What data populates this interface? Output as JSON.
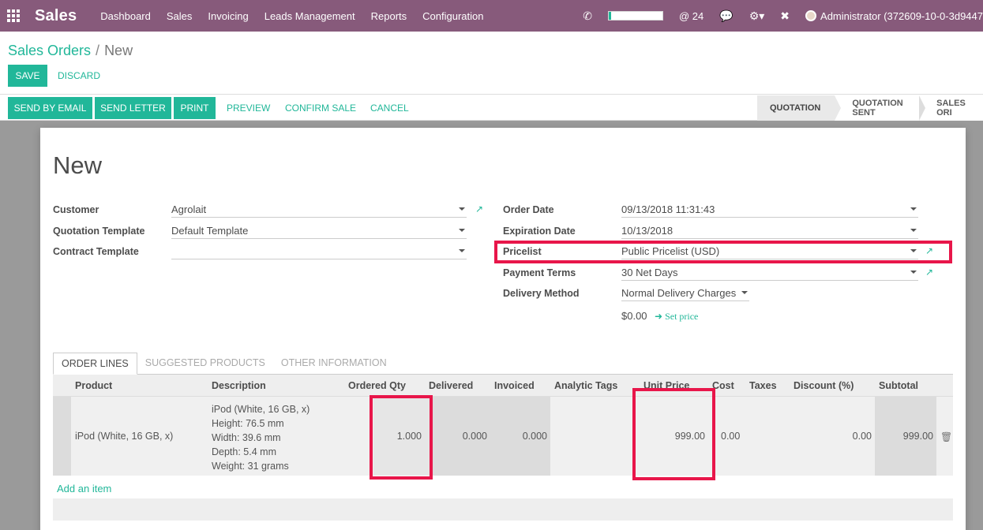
{
  "navbar": {
    "brand": "Sales",
    "menu": [
      "Dashboard",
      "Sales",
      "Invoicing",
      "Leads Management",
      "Reports",
      "Configuration"
    ],
    "progress_fraction": 0.05,
    "mentions": "@ 24",
    "user": "Administrator (372609-10-0-3d9447"
  },
  "breadcrumb": {
    "parent": "Sales Orders",
    "separator": "/",
    "current": "New"
  },
  "buttons": {
    "save": "SAVE",
    "discard": "DISCARD",
    "send_by_email": "SEND BY EMAIL",
    "send_letter": "SEND LETTER",
    "print": "PRINT",
    "preview": "PREVIEW",
    "confirm_sale": "CONFIRM SALE",
    "cancel": "CANCEL"
  },
  "status_bar": [
    "QUOTATION",
    "QUOTATION SENT",
    "SALES ORI"
  ],
  "form": {
    "title": "New",
    "customer": {
      "label": "Customer",
      "value": "Agrolait"
    },
    "quotation_template": {
      "label": "Quotation Template",
      "value": "Default Template"
    },
    "contract_template": {
      "label": "Contract Template",
      "value": ""
    },
    "order_date": {
      "label": "Order Date",
      "value": "09/13/2018 11:31:43"
    },
    "expiration_date": {
      "label": "Expiration Date",
      "value": "10/13/2018"
    },
    "pricelist": {
      "label": "Pricelist",
      "value": "Public Pricelist (USD)"
    },
    "payment_terms": {
      "label": "Payment Terms",
      "value": "30 Net Days"
    },
    "delivery_method": {
      "label": "Delivery Method",
      "value": "Normal Delivery Charges"
    },
    "delivery_amount": "$0.00",
    "set_price": "Set price"
  },
  "tabs": [
    "ORDER LINES",
    "SUGGESTED PRODUCTS",
    "OTHER INFORMATION"
  ],
  "table": {
    "headers": [
      "Product",
      "Description",
      "Ordered Qty",
      "Delivered",
      "Invoiced",
      "Analytic Tags",
      "Unit Price",
      "Cost",
      "Taxes",
      "Discount (%)",
      "Subtotal"
    ],
    "rows": [
      {
        "product": "iPod (White, 16 GB, x)",
        "description": [
          "iPod (White, 16 GB, x)",
          "Height: 76.5 mm",
          "Width:  39.6 mm",
          "Depth:  5.4 mm",
          "Weight: 31 grams"
        ],
        "ordered_qty": "1.000",
        "delivered": "0.000",
        "invoiced": "0.000",
        "analytic_tags": "",
        "unit_price": "999.00",
        "cost": "0.00",
        "taxes": "",
        "discount": "0.00",
        "subtotal": "999.00"
      }
    ],
    "add_item": "Add an item"
  },
  "colors": {
    "navbar": "#875a7b",
    "accent": "#21b799",
    "highlight": "#e8164a"
  },
  "icons": [
    "apps-grid-icon",
    "phone-icon",
    "chat-icon",
    "bug-icon",
    "tools-icon",
    "external-link-icon",
    "arrow-right-icon",
    "trash-icon"
  ]
}
